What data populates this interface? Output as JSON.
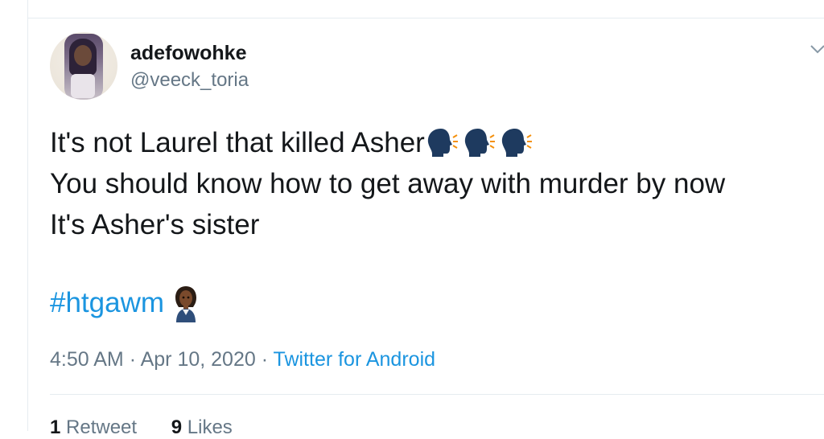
{
  "user": {
    "display_name": "adefowohke",
    "handle": "@veeck_toria"
  },
  "tweet": {
    "lines": [
      "It's not Laurel that killed Asher",
      "You should know how to get away with murder by now",
      "It's Asher's sister"
    ],
    "hashtag": "#htgawm",
    "emoji_names": [
      "speaking-head-icon",
      "speaking-head-icon",
      "speaking-head-icon",
      "woman-office-worker-icon"
    ]
  },
  "meta": {
    "time": "4:50 AM",
    "separator": "·",
    "date": "Apr 10, 2020",
    "source": "Twitter for Android"
  },
  "stats": {
    "retweets_count": "1",
    "retweets_label": "Retweet",
    "likes_count": "9",
    "likes_label": "Likes"
  },
  "colors": {
    "text": "#14171a",
    "secondary": "#657786",
    "link": "#1b95e0",
    "divider": "#e6ecf0"
  }
}
